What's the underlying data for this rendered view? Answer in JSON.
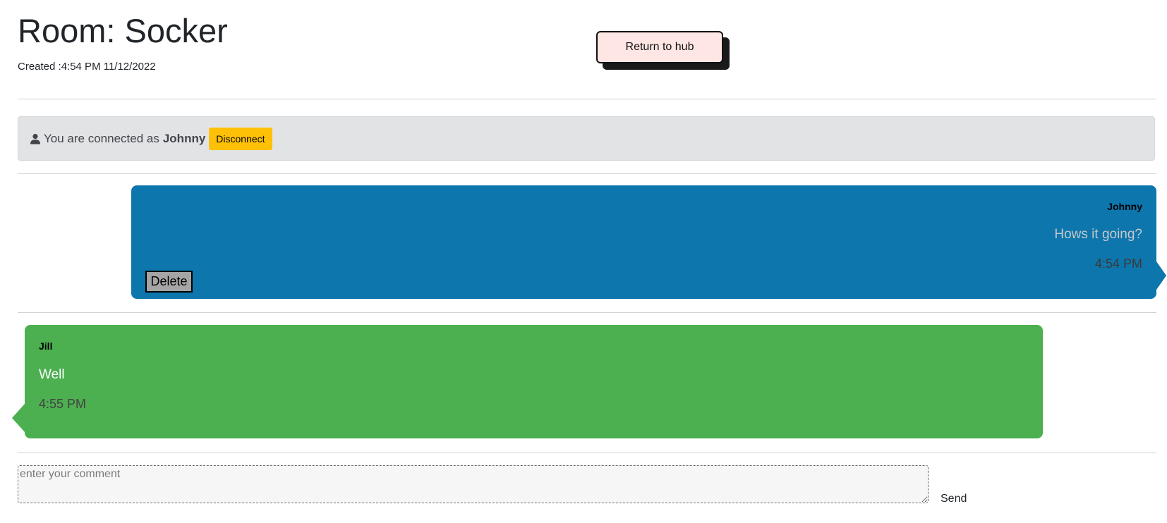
{
  "header": {
    "title": "Room: Socker",
    "created": "Created :4:54 PM 11/12/2022",
    "return_label": "Return to hub"
  },
  "status": {
    "icon": "user-icon",
    "prefix": "You are connected as",
    "username": "Johnny",
    "disconnect_label": "Disconnect",
    "colors": {
      "bar": "#e2e3e5",
      "disconnect": "#ffc107"
    }
  },
  "messages": [
    {
      "author": "Johnny",
      "text": "Hows it going?",
      "time": "4:54 PM",
      "own": true,
      "delete_label": "Delete",
      "color": "#0c76ad"
    },
    {
      "author": "Jill",
      "text": "Well",
      "time": "4:55 PM",
      "own": false,
      "color": "#4caf50"
    }
  ],
  "composer": {
    "placeholder": "enter your comment",
    "value": "",
    "send_label": "Send"
  }
}
